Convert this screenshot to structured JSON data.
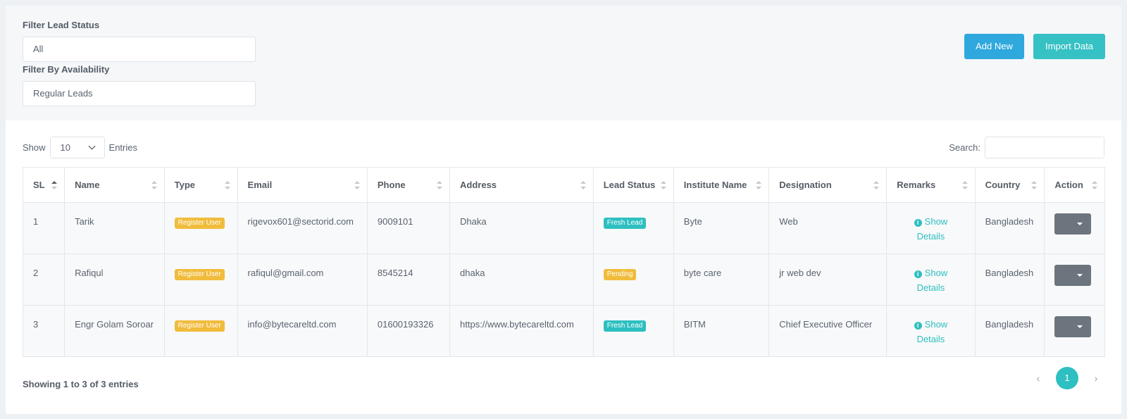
{
  "filters": {
    "lead_status_label": "Filter Lead Status",
    "lead_status_value": "All",
    "availability_label": "Filter By Availability",
    "availability_value": "Regular Leads"
  },
  "buttons": {
    "add_new": "Add New",
    "import_data": "Import Data"
  },
  "table_controls": {
    "show_label": "Show",
    "entries_value": "10",
    "entries_label": "Entries",
    "search_label": "Search:"
  },
  "columns": [
    "SL",
    "Name",
    "Type",
    "Email",
    "Phone",
    "Address",
    "Lead Status",
    "Institute Name",
    "Designation",
    "Remarks",
    "Country",
    "Action"
  ],
  "rows": [
    {
      "sl": "1",
      "name": "Tarik",
      "type": "Register User",
      "email": "rigevox601@sectorid.com",
      "phone": "9009101",
      "address": "Dhaka",
      "lead_status": "Fresh Lead",
      "institute": "Byte",
      "designation": "Web",
      "remarks_line1": "Show",
      "remarks_line2": "Details",
      "country": "Bangladesh"
    },
    {
      "sl": "2",
      "name": "Rafiqul",
      "type": "Register User",
      "email": "rafiqul@gmail.com",
      "phone": "8545214",
      "address": "dhaka",
      "lead_status": "Pending",
      "institute": "byte care",
      "designation": "jr web dev",
      "remarks_line1": "Show",
      "remarks_line2": "Details",
      "country": "Bangladesh"
    },
    {
      "sl": "3",
      "name": "Engr Golam Soroar",
      "type": "Register User",
      "email": "info@bytecareltd.com",
      "phone": "01600193326",
      "address": "https://www.bytecareltd.com",
      "lead_status": "Fresh Lead",
      "institute": "BITM",
      "designation": "Chief Executive Officer",
      "remarks_line1": "Show",
      "remarks_line2": "Details",
      "country": "Bangladesh"
    }
  ],
  "footer": {
    "info": "Showing 1 to 3 of 3 entries",
    "current_page": "1",
    "prev_arrow": "‹",
    "next_arrow": "›"
  },
  "colors": {
    "add_button": "#2fa8dd",
    "import_button": "#36c1c4",
    "badge_register": "#f1bc3c",
    "badge_fresh": "#2ebfc1",
    "badge_pending": "#f1bc3c",
    "action_button": "#6c757d"
  }
}
